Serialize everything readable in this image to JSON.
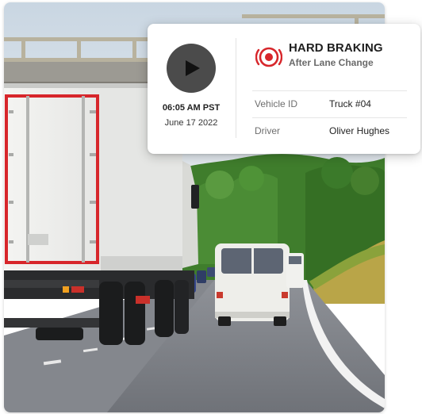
{
  "event": {
    "title": "HARD BRAKING",
    "subtitle": "After Lane Change",
    "time": "06:05 AM PST",
    "date": "June 17 2022",
    "icon": "hard-braking-icon",
    "play_icon": "play-icon",
    "details": [
      {
        "label": "Vehicle ID",
        "value": "Truck #04"
      },
      {
        "label": "Driver",
        "value": "Oliver Hughes"
      }
    ]
  },
  "colors": {
    "accent_red": "#d7262b",
    "play_button": "#4b4b4b",
    "road": "#7d8087",
    "trees": "#3f7d2c",
    "sky": "#d9e2ea"
  }
}
